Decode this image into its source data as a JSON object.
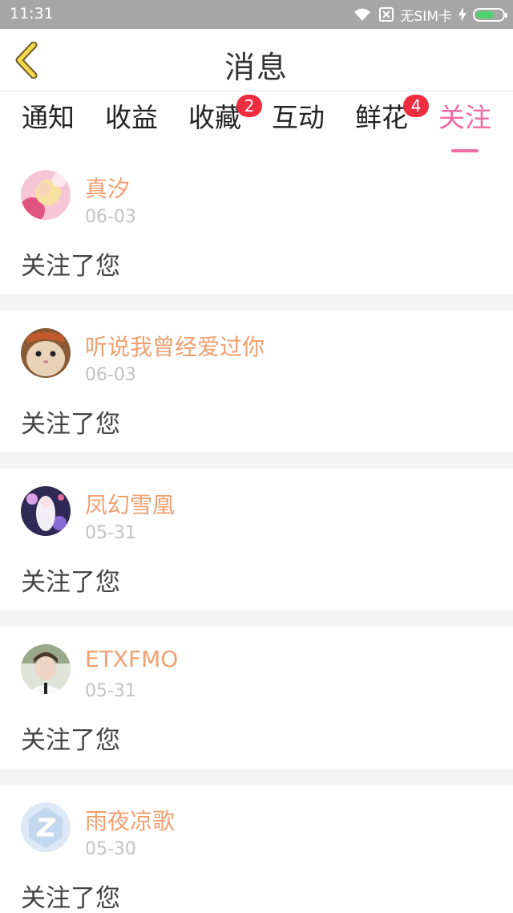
{
  "status_bar": {
    "time": "11:31",
    "carrier": "无SIM卡",
    "icons": [
      "wifi-icon",
      "sim-none-icon",
      "charging-bolt-icon",
      "battery-icon"
    ],
    "battery_level": 0.7,
    "battery_color": "#52d26a"
  },
  "header": {
    "title": "消息",
    "back_icon": "chevron-left-icon",
    "back_color": "#f5d84a"
  },
  "tabs": [
    {
      "label": "通知",
      "badge": ""
    },
    {
      "label": "收益",
      "badge": ""
    },
    {
      "label": "收藏",
      "badge": "2"
    },
    {
      "label": "互动",
      "badge": ""
    },
    {
      "label": "鲜花",
      "badge": "4"
    },
    {
      "label": "关注",
      "badge": "",
      "active": true
    }
  ],
  "colors": {
    "accent": "#f06ba3",
    "username": "#f0a070",
    "badge": "#f02d3f"
  },
  "follows": [
    {
      "username": "真汐",
      "date": "06-03",
      "action": "关注了您",
      "avatar": "pink-girl-avatar"
    },
    {
      "username": "听说我曾经爱过你",
      "date": "06-03",
      "action": "关注了您",
      "avatar": "hamster-avatar"
    },
    {
      "username": "凤幻雪凰",
      "date": "05-31",
      "action": "关注了您",
      "avatar": "anime-girl-avatar"
    },
    {
      "username": "ETXFMO",
      "date": "05-31",
      "action": "关注了您",
      "avatar": "boy-photo-avatar"
    },
    {
      "username": "雨夜凉歌",
      "date": "05-30",
      "action": "关注了您",
      "avatar": "default-qq-avatar"
    }
  ]
}
